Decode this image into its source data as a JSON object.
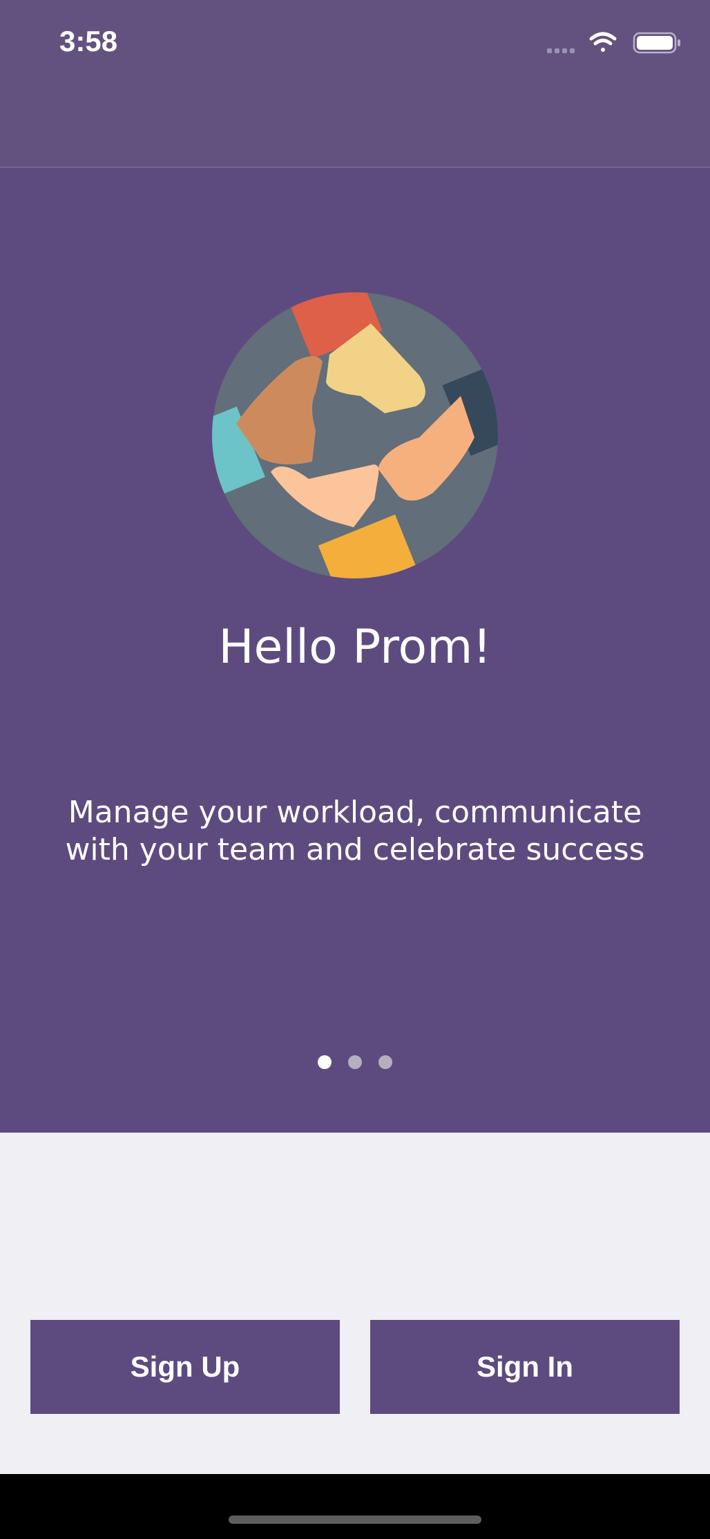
{
  "status_bar": {
    "time": "3:58",
    "icons": [
      "cellular-signal-icon",
      "wifi-icon",
      "battery-icon"
    ]
  },
  "onboarding": {
    "illustration": "team-hands-circle-icon",
    "title": "Hello Prom!",
    "description": "Manage your workload, communicate with your team and celebrate success",
    "page_count": 3,
    "current_page": 1
  },
  "actions": {
    "sign_up_label": "Sign Up",
    "sign_in_label": "Sign In"
  },
  "colors": {
    "brand_purple": "#5d4b80",
    "status_bar_purple": "#63527f",
    "bottom_background": "#efeff4",
    "dot_active": "#ffffff",
    "dot_inactive": "#b4b0bd"
  }
}
